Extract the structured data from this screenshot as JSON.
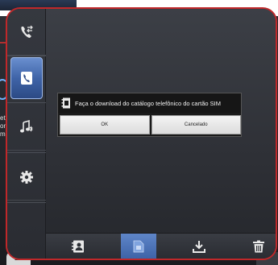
{
  "dialog": {
    "title": "Faça o download do catálogo telefônico do cartão SIM",
    "ok_label": "OK",
    "cancel_label": "Cancelado"
  },
  "background_text": {
    "line1": "ete",
    "line2": "on",
    "line3": "m"
  },
  "sidebar": {
    "items": [
      {
        "icon": "phone-transfer-icon"
      },
      {
        "icon": "phonebook-icon",
        "active": true
      },
      {
        "icon": "bluetooth-music-icon"
      },
      {
        "icon": "gear-icon"
      }
    ]
  },
  "toolbar": {
    "items": [
      {
        "icon": "contacts-icon"
      },
      {
        "icon": "sim-card-icon",
        "active": true
      },
      {
        "icon": "download-icon"
      },
      {
        "icon": "trash-icon"
      }
    ]
  },
  "colors": {
    "frame_border": "#c0282a",
    "active_blue": "#3f64a8",
    "dialog_bg": "#1a1a1a"
  }
}
